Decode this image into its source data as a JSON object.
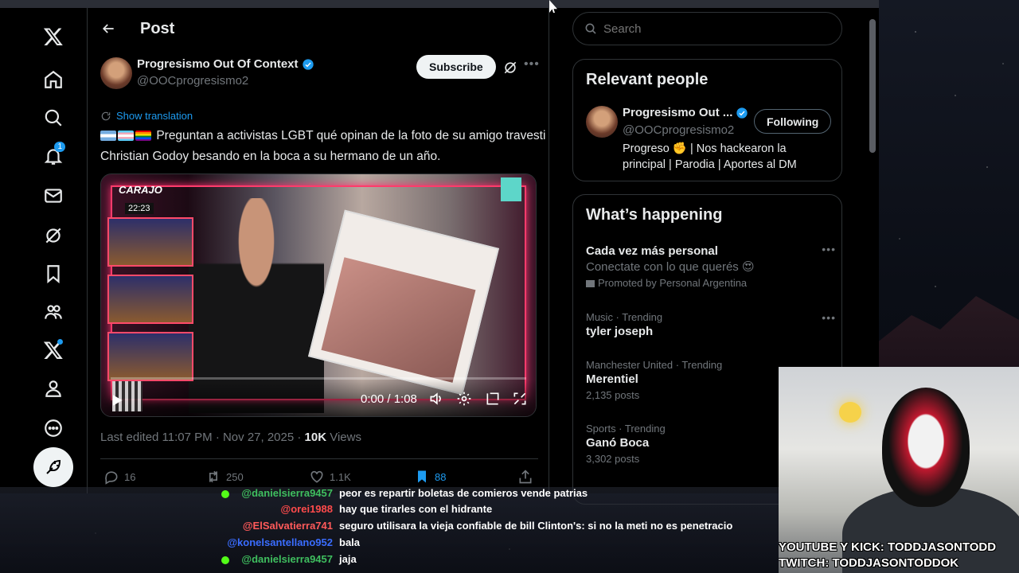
{
  "nav": {
    "notifications_badge": "1"
  },
  "header": {
    "title": "Post"
  },
  "post": {
    "author_name": "Progresismo Out Of Context",
    "author_handle": "@OOCprogresismo2",
    "subscribe_label": "Subscribe",
    "show_translation": "Show translation",
    "text": "Preguntan a activistas LGBT qué opinan de la foto de su amigo travesti Christian Godoy besando en la boca a su hermano de un año.",
    "video": {
      "overlay_brand": "CARAJO",
      "overlay_clock": "22:23",
      "time": "0:00 / 1:08"
    },
    "edited": "Last edited 11:07 PM · Nov 27, 2025 · ",
    "views_count": "10K",
    "views_label": " Views",
    "replies": "16",
    "reposts": "250",
    "likes": "1.1K",
    "bookmarks": "88"
  },
  "search": {
    "placeholder": "Search"
  },
  "relevant_people": {
    "title": "Relevant people",
    "name": "Progresismo Out ...",
    "handle": "@OOCprogresismo2",
    "follow_label": "Following",
    "bio_part1": "Progreso ",
    "bio_emoji": "✊",
    "bio_part2": " | Nos hackearon la principal | Parodia | Aportes al DM"
  },
  "whats_happening": {
    "title": "What’s happening",
    "promo": {
      "name": "Cada vez más personal",
      "sub": "Conectate con lo que querés 😍",
      "promoted": "Promoted by Personal Argentina"
    },
    "trends": [
      {
        "category": "Music · Trending",
        "name": "tyler joseph",
        "posts": ""
      },
      {
        "category": "Manchester United · Trending",
        "name": "Merentiel",
        "posts": "2,135 posts"
      },
      {
        "category": "Sports · Trending",
        "name": "Ganó Boca",
        "posts": "3,302 posts"
      }
    ]
  },
  "chat": [
    {
      "user": "@danielsierra9457",
      "color": "#3fbf5f",
      "msg": "peor es repartir boletas de comieros vende patrias"
    },
    {
      "user": "@orei1988",
      "color": "#ff4b4b",
      "msg": "hay que tirarles con el hidrante"
    },
    {
      "user": "@ElSalvatierra741",
      "color": "#ff5a5a",
      "msg": "seguro utilisara la vieja confiable de bill Clinton's: si no la meti no es penetracio"
    },
    {
      "user": "@konelsantellano952",
      "color": "#3a6dff",
      "msg": "bala"
    },
    {
      "user": "@danielsierra9457",
      "color": "#3fbf5f",
      "msg": "jaja"
    }
  ],
  "webcam": {
    "line1": "YOUTUBE Y KICK: TODDJASONTODD",
    "line2": "TWITCH: TODDJASONTODDOK"
  },
  "colors": {
    "accent": "#1d9bf0",
    "background": "#000000",
    "border": "#2f3336"
  }
}
